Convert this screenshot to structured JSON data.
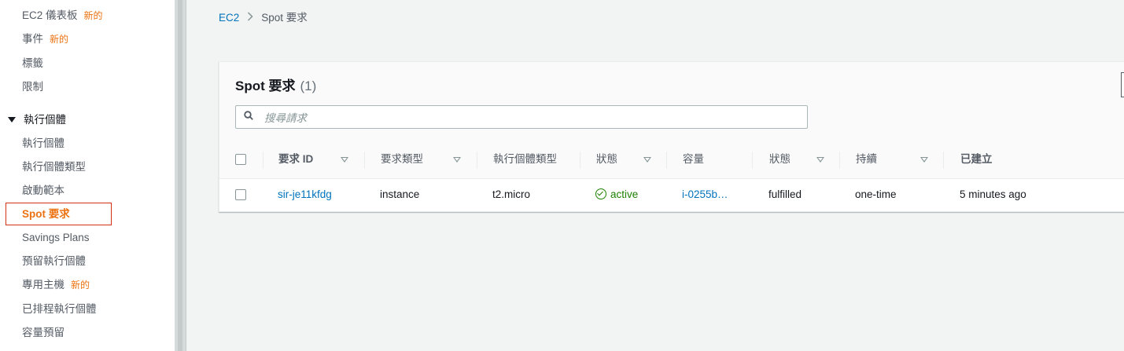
{
  "sidebar": {
    "items_top": [
      {
        "label": "EC2 儀表板",
        "badge": "新的"
      },
      {
        "label": "事件",
        "badge": "新的"
      },
      {
        "label": "標籤",
        "badge": ""
      },
      {
        "label": "限制",
        "badge": ""
      }
    ],
    "section": "執行個體",
    "items_instances": [
      {
        "label": "執行個體",
        "badge": ""
      },
      {
        "label": "執行個體類型",
        "badge": ""
      },
      {
        "label": "啟動範本",
        "badge": ""
      },
      {
        "label": "Spot 要求",
        "badge": ""
      },
      {
        "label": "Savings Plans",
        "badge": ""
      },
      {
        "label": "預留執行個體",
        "badge": ""
      },
      {
        "label": "專用主機",
        "badge": "新的"
      },
      {
        "label": "已排程執行個體",
        "badge": ""
      },
      {
        "label": "容量預留",
        "badge": ""
      }
    ]
  },
  "breadcrumb": {
    "root": "EC2",
    "current": "Spot 要求"
  },
  "panel": {
    "title": "Spot 要求",
    "count": "(1)",
    "search_placeholder": "搜尋請求"
  },
  "table": {
    "columns": [
      "要求 ID",
      "要求類型",
      "執行個體類型",
      "狀態",
      "容量",
      "狀態",
      "持續",
      "已建立"
    ],
    "rows": [
      {
        "request_id": "sir-je11kfdg",
        "request_type": "instance",
        "instance_type": "t2.micro",
        "state": "active",
        "capacity": "i-0255b…",
        "status": "fulfilled",
        "persistence": "one-time",
        "created": "5 minutes ago"
      }
    ]
  },
  "colors": {
    "accent": "#ec7211",
    "link": "#0073bb",
    "success": "#1d8102"
  }
}
